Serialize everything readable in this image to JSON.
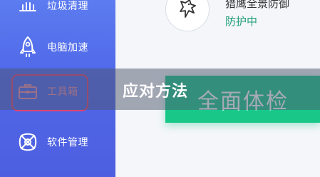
{
  "sidebar": {
    "items": [
      {
        "label": "垃圾清理",
        "icon": "broom-icon"
      },
      {
        "label": "电脑加速",
        "icon": "rocket-icon"
      },
      {
        "label": "工具箱",
        "icon": "toolbox-icon"
      },
      {
        "label": "软件管理",
        "icon": "software-icon"
      }
    ]
  },
  "protection": {
    "product_name": "猎鹰全景防御",
    "status": "防护中",
    "icon": "eagle-icon"
  },
  "scan_button": {
    "label": "全面体检"
  },
  "overlay": {
    "caption": "应对方法"
  },
  "colors": {
    "sidebar": "#4f67e8",
    "scan_button": "#19c789",
    "status": "#1f9e74",
    "highlight_ring": "#e0436d"
  }
}
